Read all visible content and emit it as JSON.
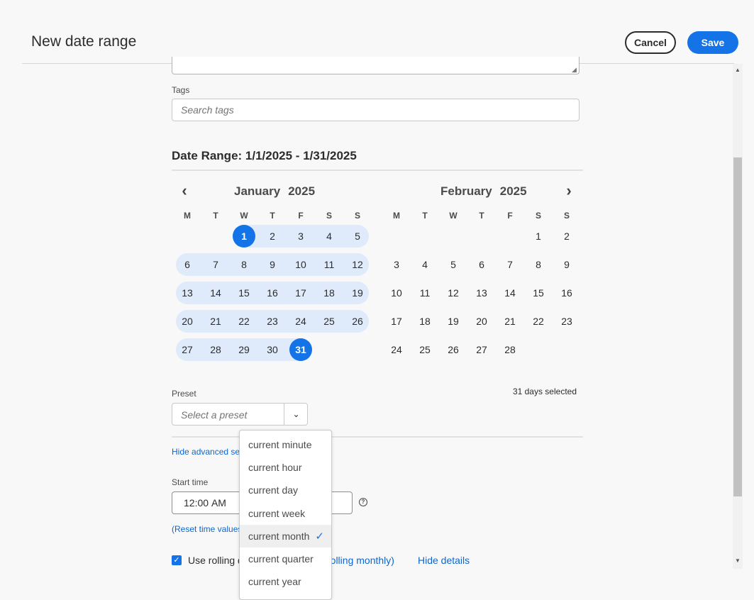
{
  "header": {
    "title": "New date range",
    "cancel_label": "Cancel",
    "save_label": "Save"
  },
  "tags": {
    "label": "Tags",
    "placeholder": "Search tags"
  },
  "date_range": {
    "title": "Date Range: 1/1/2025 - 1/31/2025"
  },
  "calendar": {
    "left": {
      "month": "January",
      "year": "2025"
    },
    "right": {
      "month": "February",
      "year": "2025"
    },
    "weekdays": [
      "M",
      "T",
      "W",
      "T",
      "F",
      "S",
      "S"
    ],
    "january_days": [
      "1",
      "2",
      "3",
      "4",
      "5",
      "6",
      "7",
      "8",
      "9",
      "10",
      "11",
      "12",
      "13",
      "14",
      "15",
      "16",
      "17",
      "18",
      "19",
      "20",
      "21",
      "22",
      "23",
      "24",
      "25",
      "26",
      "27",
      "28",
      "29",
      "30",
      "31"
    ],
    "february_days": [
      "1",
      "2",
      "3",
      "4",
      "5",
      "6",
      "7",
      "8",
      "9",
      "10",
      "11",
      "12",
      "13",
      "14",
      "15",
      "16",
      "17",
      "18",
      "19",
      "20",
      "21",
      "22",
      "23",
      "24",
      "25",
      "26",
      "27",
      "28"
    ],
    "range_start": "1",
    "range_end": "31"
  },
  "preset": {
    "label": "Preset",
    "placeholder": "Select a preset",
    "days_selected": "31 days selected"
  },
  "advanced": {
    "hide_label": "Hide advanced setti"
  },
  "start_time": {
    "label": "Start time",
    "hours": "12",
    "minutes": "00",
    "ampm": "AM",
    "reset_label": "(Reset time values)",
    "help_icon": "help-icon"
  },
  "rolling": {
    "checked": true,
    "label": "Use rolling d",
    "suffix": "rolling monthly)",
    "details_link": "Hide details"
  },
  "preset_menu": {
    "items": [
      "current minute",
      "current hour",
      "current day",
      "current week",
      "current month",
      "current quarter",
      "current year"
    ],
    "selected": "current month"
  },
  "colors": {
    "accent": "#1473e6",
    "range_fill": "#dfeafa",
    "link": "#0d66d0"
  }
}
